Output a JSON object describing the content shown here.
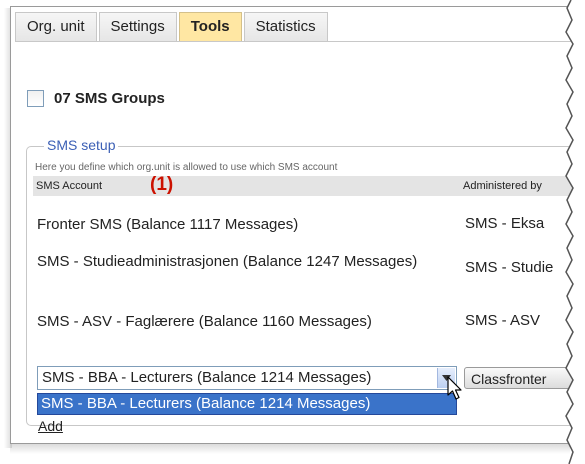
{
  "tabs": [
    {
      "label": "Org. unit"
    },
    {
      "label": "Settings"
    },
    {
      "label": "Tools"
    },
    {
      "label": "Statistics"
    }
  ],
  "active_tab": "Tools",
  "group": {
    "title": "07 SMS Groups"
  },
  "sms_setup": {
    "legend": "SMS setup",
    "hint": "Here you define which org.unit is allowed to use which SMS account",
    "columns": {
      "account": "SMS Account",
      "administered_by": "Administered by"
    },
    "callout": "(1)",
    "rows": [
      {
        "account": "Fronter SMS (Balance 1117 Messages)",
        "admin": "SMS - Eksa"
      },
      {
        "account": "SMS - Studieadministrasjonen (Balance 1247 Messages)",
        "admin": "SMS - Studie"
      },
      {
        "account": "SMS - ASV - Faglærere (Balance 1160 Messages)",
        "admin": "SMS - ASV"
      }
    ],
    "select": {
      "value": "SMS - BBA - Lecturers (Balance 1214 Messages)"
    },
    "dropdown_option": "SMS - BBA - Lecturers (Balance 1214 Messages)",
    "classfronter_button": "Classfronter",
    "add_link": "Add"
  },
  "icons": {
    "checkbox": "checkbox-icon",
    "dropdown": "chevron-down-icon",
    "cursor": "mouse-pointer-icon"
  }
}
